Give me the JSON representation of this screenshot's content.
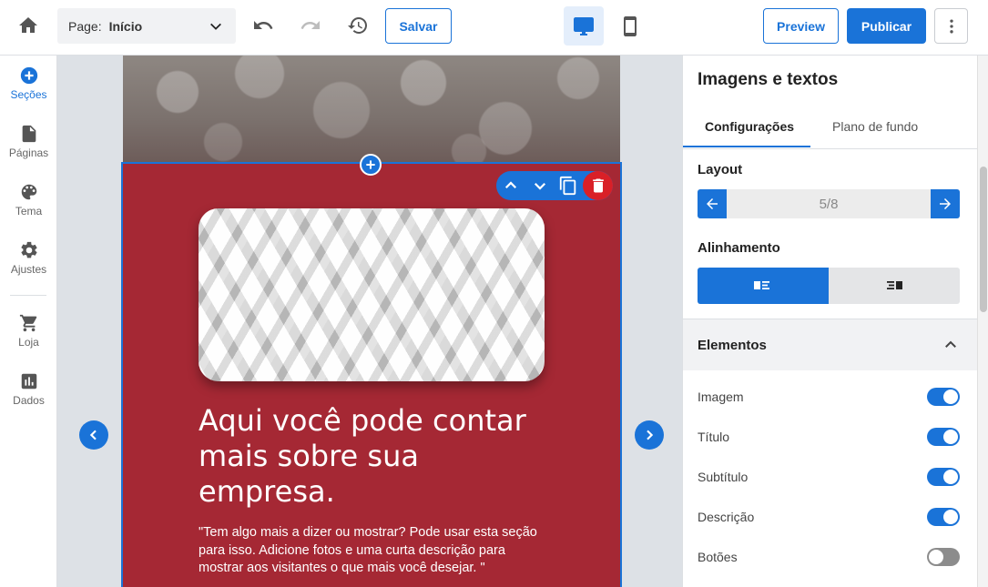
{
  "toolbar": {
    "page_label": "Page:",
    "page_value": "Início",
    "save_label": "Salvar",
    "preview_label": "Preview",
    "publish_label": "Publicar"
  },
  "sidebar": {
    "items": [
      {
        "label": "Seções",
        "icon": "add-circle-icon",
        "active": true
      },
      {
        "label": "Páginas",
        "icon": "page-icon"
      },
      {
        "label": "Tema",
        "icon": "palette-icon"
      },
      {
        "label": "Ajustes",
        "icon": "gear-icon"
      },
      {
        "label": "Loja",
        "icon": "cart-icon"
      },
      {
        "label": "Dados",
        "icon": "chart-icon"
      }
    ]
  },
  "section": {
    "title": "Aqui você pode contar mais sobre sua empresa.",
    "description": "\"Tem algo mais a dizer ou mostrar? Pode usar esta seção para isso. Adicione fotos e uma curta descrição para mostrar aos visitantes o que mais você desejar. \"",
    "background_color": "#a52834"
  },
  "panel": {
    "title": "Imagens e textos",
    "tabs": [
      {
        "label": "Configurações",
        "active": true
      },
      {
        "label": "Plano de fundo"
      }
    ],
    "layout_label": "Layout",
    "layout_value": "5/8",
    "alignment_label": "Alinhamento",
    "elements_label": "Elementos",
    "toggles": [
      {
        "label": "Imagem",
        "on": true
      },
      {
        "label": "Título",
        "on": true
      },
      {
        "label": "Subtítulo",
        "on": true
      },
      {
        "label": "Descrição",
        "on": true
      },
      {
        "label": "Botões",
        "on": false
      }
    ]
  },
  "colors": {
    "accent": "#1a73d8",
    "danger": "#d92027"
  }
}
